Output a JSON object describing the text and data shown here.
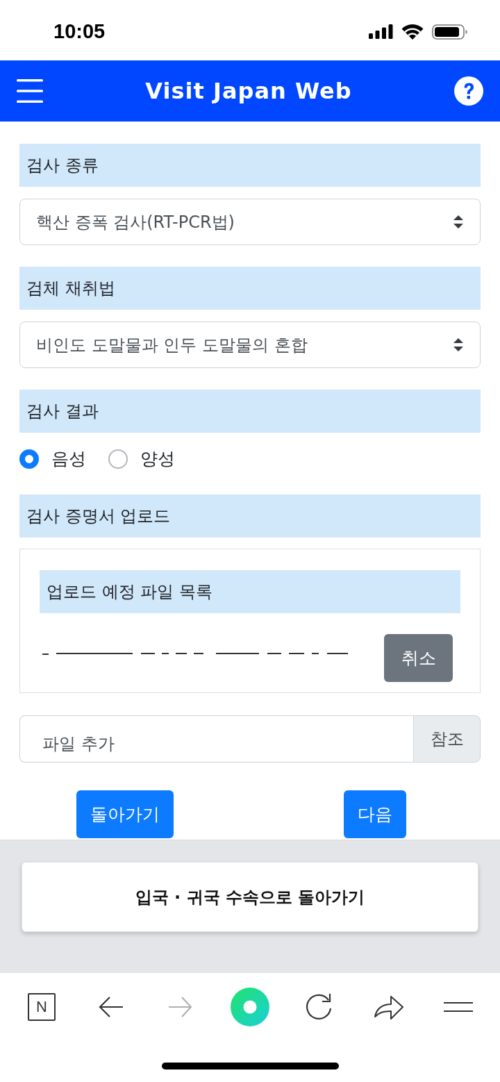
{
  "status_bar": {
    "time": "10:05"
  },
  "header": {
    "title": "Visit Japan Web"
  },
  "sections": [
    {
      "kind": "select",
      "title": "검사 종류",
      "value": "핵산 증폭 검사(RT-PCR법)"
    },
    {
      "kind": "select",
      "title": "검체 채취법",
      "value": "비인도 도말물과 인두 도말물의 혼합"
    },
    {
      "kind": "radio",
      "title": "검사 결과",
      "options": [
        {
          "label": "음성",
          "selected": true
        },
        {
          "label": "양성",
          "selected": false
        }
      ]
    },
    {
      "kind": "upload",
      "title": "검사 증명서 업로드",
      "list_title": "업로드 예정 파일 목록",
      "cancel_button": "취소",
      "file_input": {
        "placeholder": "파일 추가",
        "browse_button": "참조"
      }
    }
  ],
  "nav_buttons": [
    {
      "label": "돌아가기"
    },
    {
      "label": "다음"
    }
  ],
  "return_card": {
    "label": "입국 · 귀국 수속으로 돌아가기"
  },
  "browser_toolbar": {
    "tabs_label": "N",
    "back_disabled": false,
    "forward_disabled": true
  }
}
